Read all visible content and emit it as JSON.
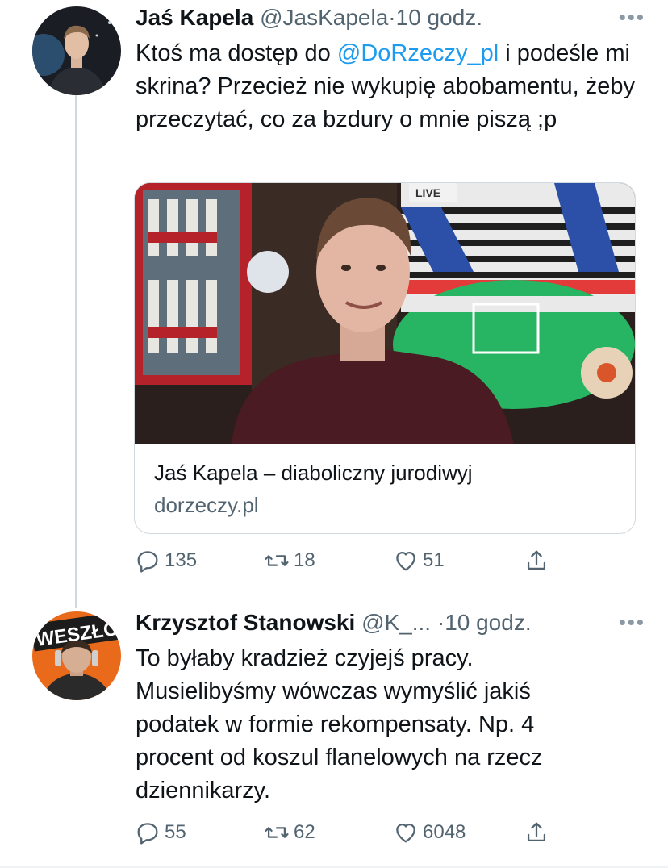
{
  "tweet1": {
    "name": "Jaś Kapela",
    "handle": "@JasKapela",
    "separator": "·",
    "time": "10 godz.",
    "more": "•••",
    "text_before": "Ktoś ma dostęp do ",
    "mention": "@DoRzeczy_pl",
    "text_after": " i podeśle mi skrina? Przecież nie wykupię abobamentu, żeby przeczytać, co za bzdury o mnie piszą ;p",
    "card": {
      "title": "Jaś Kapela – diaboliczny jurodiwyj",
      "domain": "dorzeczy.pl",
      "sign_text": "LIVE"
    },
    "actions": {
      "reply_count": "135",
      "retweet_count": "18",
      "like_count": "51"
    }
  },
  "tweet2": {
    "name": "Krzysztof Stanowski",
    "handle": "@K_...",
    "separator": "·",
    "time": "10 godz.",
    "more": "•••",
    "text": "To byłaby kradzież czyjejś pracy. Musielibyśmy wówczas wymyślić jakiś podatek w formie rekompensaty. Np. 4 procent od koszul flanelowych na rzecz dziennikarzy.",
    "avatar_text": "WESZŁO",
    "actions": {
      "reply_count": "55",
      "retweet_count": "62",
      "like_count": "6048"
    }
  },
  "icons": [
    "reply-icon",
    "retweet-icon",
    "like-icon",
    "share-icon",
    "more-icon"
  ],
  "colors": {
    "link": "#1d9bf0",
    "secondary": "#536471",
    "text": "#0f1419",
    "border": "#cfd9de"
  }
}
